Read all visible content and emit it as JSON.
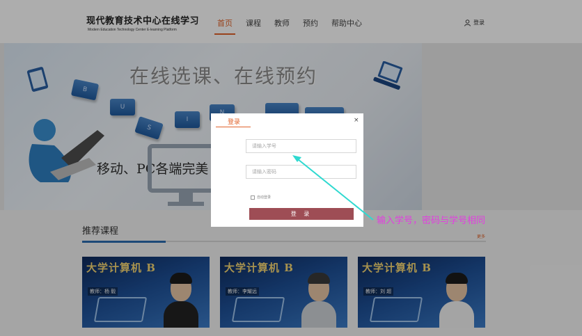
{
  "header": {
    "brand_cn": "现代教育技术中心在线学习",
    "brand_en": "Modern Education Technology Center E-learning Platform",
    "nav": [
      "首页",
      "课程",
      "教师",
      "预约",
      "帮助中心"
    ],
    "login_label": "登录"
  },
  "banner": {
    "title": "在线选课、在线预约",
    "subtitle": "移动、PC各端完美"
  },
  "section": {
    "title": "推荐课程",
    "more": "更多"
  },
  "courses": [
    {
      "title": "大学计算机 B",
      "teacher": "教师：杨 毅"
    },
    {
      "title": "大学计算机 B",
      "teacher": "教师：李耀远"
    },
    {
      "title": "大学计算机 B",
      "teacher": "教师：刘 超"
    }
  ],
  "modal": {
    "tab": "登录",
    "close": "×",
    "student_id_placeholder": "请输入学号",
    "password_placeholder": "请输入密码",
    "auto_login": "自动登录",
    "login_button": "登 录"
  },
  "annotation": {
    "hint": "输入学号，密码与学号相同",
    "color": "#e23ee0",
    "arrow_color": "#2fd9d0"
  }
}
